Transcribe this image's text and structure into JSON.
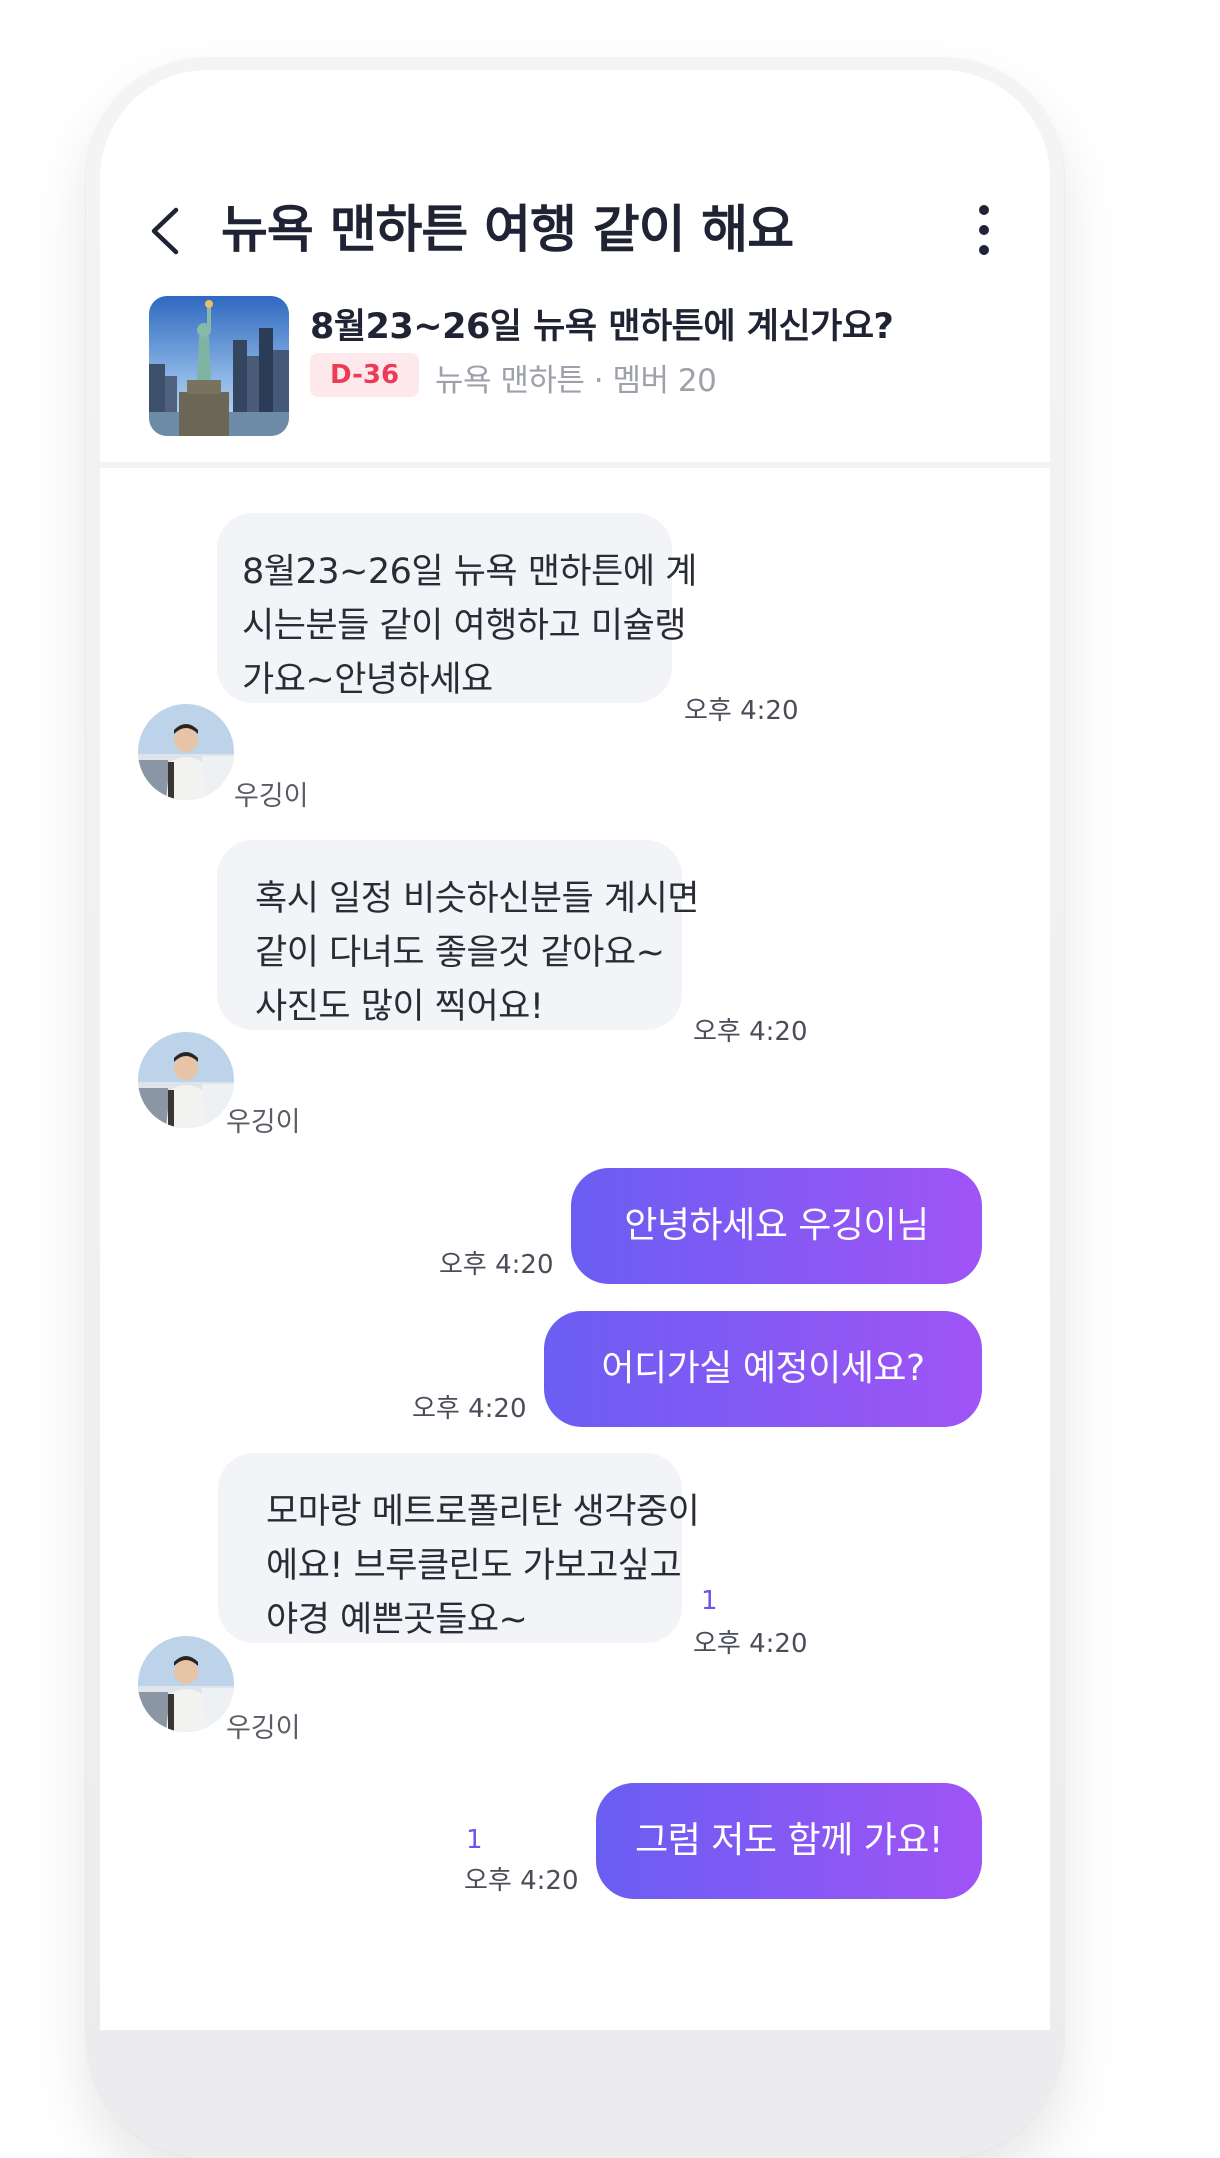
{
  "header": {
    "title": "뉴욕 맨하튼 여행 같이 해요",
    "room_title": "8월23~26일 뉴욕 맨하튼에 계신가요?",
    "dday": "D-36",
    "meta": "뉴욕 맨하튼 · 멤버 20"
  },
  "icons": {
    "back": "chevron-left-icon",
    "more": "more-vertical-icon"
  },
  "colors": {
    "outgoing_start": "#6a5ef2",
    "outgoing_end": "#a054f6",
    "incoming_bg": "#f3f4f7",
    "dday_text": "#ef3a57",
    "unread": "#6a56ee"
  },
  "messages": [
    {
      "direction": "in",
      "sender": "우깅이",
      "lines": [
        "8월23~26일 뉴욕 맨하튼에 계",
        "시는분들 같이 여행하고 미슐랭",
        "가요~안녕하세요"
      ],
      "time": "오후 4:20"
    },
    {
      "direction": "in",
      "sender": "우깅이",
      "lines": [
        "혹시 일정 비슷하신분들 계시면",
        "같이 다녀도 좋을것 같아요~",
        "사진도 많이 찍어요!"
      ],
      "time": "오후 4:20"
    },
    {
      "direction": "out",
      "text": "안녕하세요 우깅이님",
      "time": "오후 4:20"
    },
    {
      "direction": "out",
      "text": "어디가실 예정이세요?",
      "time": "오후 4:20"
    },
    {
      "direction": "in",
      "sender": "우깅이",
      "lines": [
        "모마랑 메트로폴리탄 생각중이",
        "에요! 브루클린도 가보고싶고",
        "야경 예쁜곳들요~"
      ],
      "time": "오후 4:20",
      "unread": "1"
    },
    {
      "direction": "out",
      "text": "그럼 저도 함께 가요!",
      "time": "오후 4:20",
      "unread": "1"
    }
  ]
}
